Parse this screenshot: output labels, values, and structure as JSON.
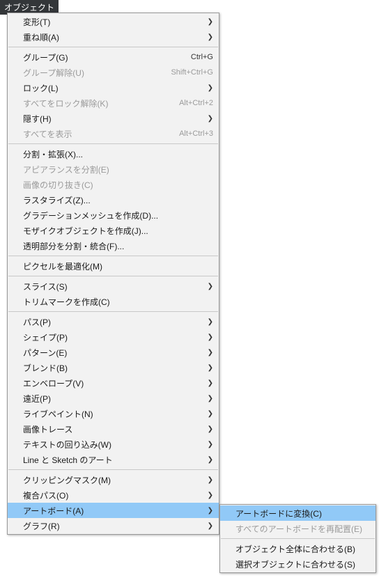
{
  "menuTitle": "オブジェクト",
  "arrow": "❯",
  "items": [
    {
      "id": "transform",
      "label": "変形(T)",
      "sub": true
    },
    {
      "id": "arrange",
      "label": "重ね順(A)",
      "sub": true
    },
    {
      "sep": true
    },
    {
      "id": "group",
      "label": "グループ(G)",
      "shortcut": "Ctrl+G"
    },
    {
      "id": "ungroup",
      "label": "グループ解除(U)",
      "shortcut": "Shift+Ctrl+G",
      "disabled": true
    },
    {
      "id": "lock",
      "label": "ロック(L)",
      "sub": true
    },
    {
      "id": "unlock-all",
      "label": "すべてをロック解除(K)",
      "shortcut": "Alt+Ctrl+2",
      "disabled": true
    },
    {
      "id": "hide",
      "label": "隠す(H)",
      "sub": true
    },
    {
      "id": "show-all",
      "label": "すべてを表示",
      "shortcut": "Alt+Ctrl+3",
      "disabled": true
    },
    {
      "sep": true
    },
    {
      "id": "expand",
      "label": "分割・拡張(X)..."
    },
    {
      "id": "expand-appearance",
      "label": "アピアランスを分割(E)",
      "disabled": true
    },
    {
      "id": "crop-image",
      "label": "画像の切り抜き(C)",
      "disabled": true
    },
    {
      "id": "rasterize",
      "label": "ラスタライズ(Z)..."
    },
    {
      "id": "gradient-mesh",
      "label": "グラデーションメッシュを作成(D)..."
    },
    {
      "id": "mosaic",
      "label": "モザイクオブジェクトを作成(J)..."
    },
    {
      "id": "flatten-transparency",
      "label": "透明部分を分割・統合(F)..."
    },
    {
      "sep": true
    },
    {
      "id": "pixel-perfect",
      "label": "ピクセルを最適化(M)"
    },
    {
      "sep": true
    },
    {
      "id": "slice",
      "label": "スライス(S)",
      "sub": true
    },
    {
      "id": "trim-marks",
      "label": "トリムマークを作成(C)"
    },
    {
      "sep": true
    },
    {
      "id": "path",
      "label": "パス(P)",
      "sub": true
    },
    {
      "id": "shape",
      "label": "シェイプ(P)",
      "sub": true
    },
    {
      "id": "pattern",
      "label": "パターン(E)",
      "sub": true
    },
    {
      "id": "blend",
      "label": "ブレンド(B)",
      "sub": true
    },
    {
      "id": "envelope",
      "label": "エンベロープ(V)",
      "sub": true
    },
    {
      "id": "perspective",
      "label": "遠近(P)",
      "sub": true
    },
    {
      "id": "live-paint",
      "label": "ライブペイント(N)",
      "sub": true
    },
    {
      "id": "image-trace",
      "label": "画像トレース",
      "sub": true
    },
    {
      "id": "text-wrap",
      "label": "テキストの回り込み(W)",
      "sub": true
    },
    {
      "id": "line-sketch",
      "label": "Line と Sketch のアート",
      "sub": true
    },
    {
      "sep": true
    },
    {
      "id": "clipping-mask",
      "label": "クリッピングマスク(M)",
      "sub": true
    },
    {
      "id": "compound-path",
      "label": "複合パス(O)",
      "sub": true
    },
    {
      "id": "artboards",
      "label": "アートボード(A)",
      "sub": true,
      "highlighted": true
    },
    {
      "id": "graph",
      "label": "グラフ(R)",
      "sub": true
    }
  ],
  "submenu": [
    {
      "id": "convert-to-artboards",
      "label": "アートボードに変換(C)",
      "highlighted": true
    },
    {
      "id": "rearrange-all",
      "label": "すべてのアートボードを再配置(E)",
      "disabled": true
    },
    {
      "sep": true
    },
    {
      "id": "fit-to-artwork",
      "label": "オブジェクト全体に合わせる(B)"
    },
    {
      "id": "fit-to-selected",
      "label": "選択オブジェクトに合わせる(S)"
    }
  ]
}
